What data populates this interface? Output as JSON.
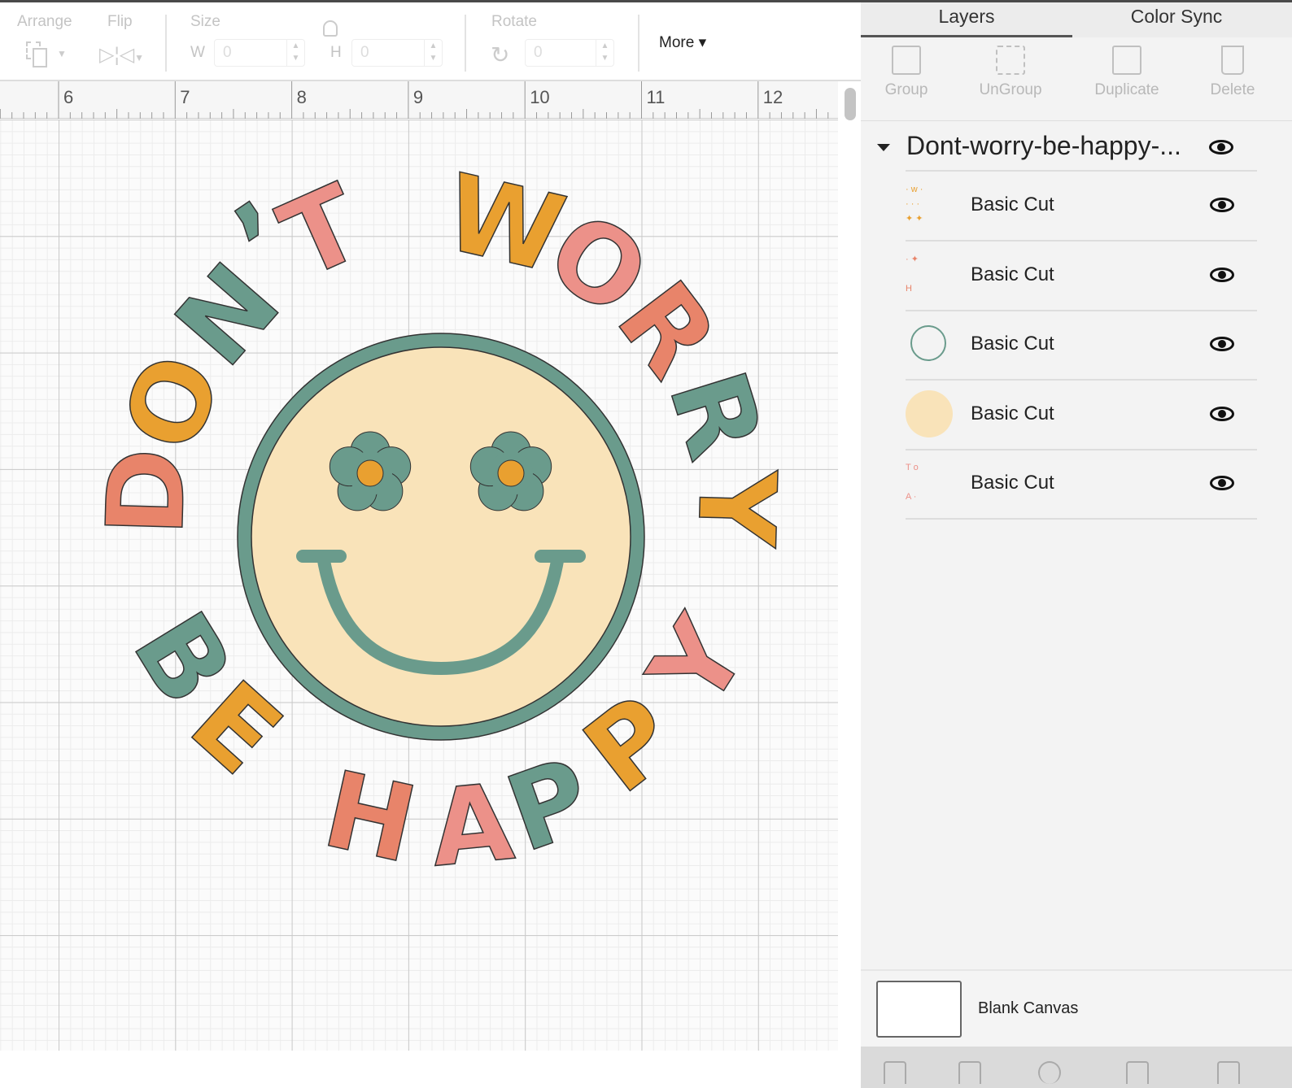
{
  "toolbar": {
    "arrange": "Arrange",
    "flip": "Flip",
    "size": "Size",
    "w_label": "W",
    "w_value": "0",
    "h_label": "H",
    "h_value": "0",
    "rotate": "Rotate",
    "rotate_value": "0",
    "more": "More ▾"
  },
  "ruler": {
    "ticks": [
      "6",
      "7",
      "8",
      "9",
      "10",
      "11",
      "12"
    ]
  },
  "design": {
    "top_letters": [
      "D",
      "O",
      "N",
      "’",
      "T",
      "W",
      "O",
      "R",
      "R",
      "Y"
    ],
    "top_colors": [
      "#e8846a",
      "#e9a030",
      "#6a9b8c",
      "#6a9b8c",
      "#ec9189",
      "#e9a030",
      "#ec9189",
      "#e8846a",
      "#6a9b8c",
      "#e9a030"
    ],
    "bottom_letters": [
      "B",
      "E",
      "H",
      "A",
      "P",
      "P",
      "Y"
    ],
    "bottom_colors": [
      "#6a9b8c",
      "#e9a030",
      "#e8846a",
      "#ec9189",
      "#6a9b8c",
      "#e9a030",
      "#ec9189"
    ],
    "colors": {
      "teal": "#6a9b8c",
      "face": "#f9e3b9",
      "orange": "#e9a030"
    }
  },
  "panel": {
    "tabs": [
      "Layers",
      "Color Sync"
    ],
    "actions": [
      "Group",
      "UnGroup",
      "Duplicate",
      "Delete"
    ],
    "group_title": "Dont-worry-be-happy-...",
    "layers": [
      {
        "name": "Basic Cut"
      },
      {
        "name": "Basic Cut"
      },
      {
        "name": "Basic Cut"
      },
      {
        "name": "Basic Cut"
      },
      {
        "name": "Basic Cut"
      }
    ],
    "blank_canvas": "Blank Canvas"
  }
}
